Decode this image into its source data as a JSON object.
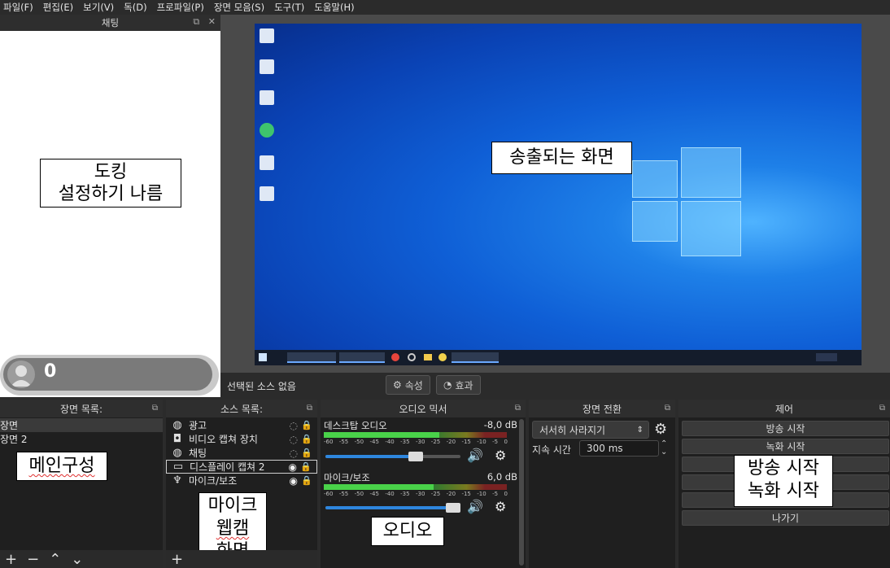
{
  "menubar": [
    "파일(F)",
    "편집(E)",
    "보기(V)",
    "독(D)",
    "프로파일(P)",
    "장면 모음(S)",
    "도구(T)",
    "도움말(H)"
  ],
  "chat_dock": {
    "title": "채팅",
    "annotation_line1": "도킹",
    "annotation_line2": "설정하기 나름",
    "viewer_count": "0"
  },
  "preview": {
    "annotation": "송출되는 화면"
  },
  "source_bar": {
    "no_source": "선택된 소스 없음",
    "properties_label": "속성",
    "filters_label": "효과"
  },
  "scenes": {
    "title": "장면 목록:",
    "items": [
      "장면",
      "장면 2"
    ],
    "annotation": "메인구성"
  },
  "sources": {
    "title": "소스 목록:",
    "items": [
      {
        "label": "광고",
        "icon": "globe-icon"
      },
      {
        "label": "비디오 캡쳐 장치",
        "icon": "camera-icon"
      },
      {
        "label": "채팅",
        "icon": "globe-icon"
      },
      {
        "label": "디스플레이 캡쳐 2",
        "icon": "monitor-icon"
      },
      {
        "label": "마이크/보조",
        "icon": "mic-icon"
      }
    ],
    "annotation_line1": "마이크",
    "annotation_line2": "웹캠",
    "annotation_line3": "화면"
  },
  "mixer": {
    "title": "오디오 믹서",
    "tracks": [
      {
        "name": "데스크탑 오디오",
        "db": "-8,0 dB",
        "level": 0.63,
        "volume": 0.72
      },
      {
        "name": "마이크/보조",
        "db": "6,0 dB",
        "level": 0.6,
        "volume": 1.0
      }
    ],
    "ticks": [
      "-60",
      "-55",
      "-50",
      "-45",
      "-40",
      "-35",
      "-30",
      "-25",
      "-20",
      "-15",
      "-10",
      "-5",
      "0"
    ],
    "annotation": "오디오"
  },
  "transitions": {
    "title": "장면 전환",
    "selected": "서서히 사라지기",
    "duration_label": "지속 시간",
    "duration_value": "300 ms"
  },
  "controls": {
    "title": "제어",
    "start_streaming": "방송 시작",
    "start_recording": "녹화 시작",
    "exit": "나가기",
    "annotation_line1": "방송 시작",
    "annotation_line2": "녹화 시작"
  },
  "colors": {
    "accent": "#2e86de",
    "background": "#2b2b2b",
    "dock_bg": "#1f1f1f"
  }
}
